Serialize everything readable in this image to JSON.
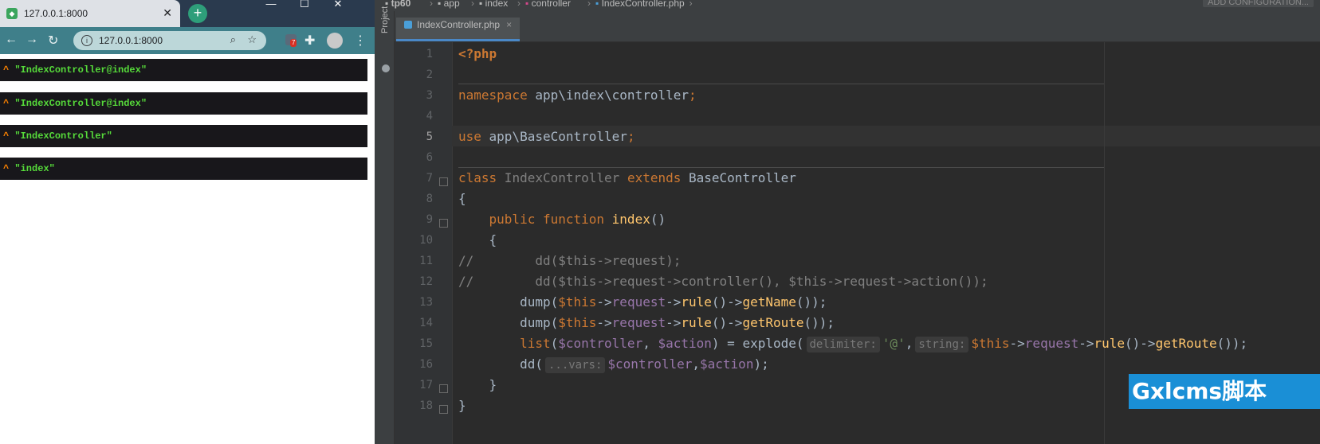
{
  "browser": {
    "tab_title": "127.0.0.1:8000",
    "tab_close": "✕",
    "new_tab": "+",
    "window_buttons": [
      "—",
      "☐",
      "✕"
    ],
    "url": "127.0.0.1:8000",
    "extension_badge": "7",
    "dumps": [
      "\"IndexController@index\"",
      "\"IndexController@index\"",
      "\"IndexController\"",
      "\"index\""
    ],
    "dump_prefix": "^"
  },
  "ide": {
    "breadcrumb": [
      "tp60",
      "app",
      "index",
      "controller",
      "IndexController.php"
    ],
    "add_configuration": "ADD CONFIGURATION...",
    "project_label": "Project",
    "active_tab": "IndexController.php",
    "tab_close": "×",
    "line_numbers": [
      "1",
      "2",
      "3",
      "4",
      "5",
      "6",
      "7",
      "8",
      "9",
      "10",
      "11",
      "12",
      "13",
      "14",
      "15",
      "16",
      "17",
      "18"
    ],
    "current_line": 5,
    "code": {
      "l1": "<?php",
      "l3_kw": "namespace",
      "l3_rest": " app\\index\\controller",
      "l3_semi": ";",
      "l5_kw": "use",
      "l5_rest": " app\\BaseController",
      "l5_semi": ";",
      "l7_kw1": "class",
      "l7_name": " IndexController ",
      "l7_kw2": "extends",
      "l7_base": " BaseController",
      "l8": "{",
      "l9_indent": "    ",
      "l9_kw": "public function",
      "l9_fn": " index",
      "l9_rest": "()",
      "l10": "    {",
      "l11": "//        dd($this->request);",
      "l12": "//        dd($this->request->controller(), $this->request->action());",
      "l13_a": "        dump(",
      "l13_var": "$this",
      "l13_b": "->",
      "l13_m1": "request",
      "l13_c": "->",
      "l13_f1": "rule",
      "l13_d": "()->",
      "l13_f2": "getName",
      "l13_e": "());",
      "l14_a": "        dump(",
      "l14_var": "$this",
      "l14_b": "->",
      "l14_m1": "request",
      "l14_c": "->",
      "l14_f1": "rule",
      "l14_d": "()->",
      "l14_f2": "getRoute",
      "l14_e": "());",
      "l15_kw": "        list",
      "l15_a": "(",
      "l15_v1": "$controller",
      "l15_b": ", ",
      "l15_v2": "$action",
      "l15_c": ") = explode(",
      "l15_hint1": "delimiter:",
      "l15_str": "'@'",
      "l15_d": ",",
      "l15_hint2": "string:",
      "l15_var": "$this",
      "l15_e": "->",
      "l15_m1": "request",
      "l15_f": "->",
      "l15_f1": "rule",
      "l15_g": "()->",
      "l15_f2": "getRoute",
      "l15_h": "());",
      "l16_a": "        dd(",
      "l16_hint": "...vars:",
      "l16_v1": "$controller",
      "l16_b": ",",
      "l16_v2": "$action",
      "l16_c": ");",
      "l17": "    }",
      "l18": "}"
    }
  },
  "watermark": "Gxlcms脚本"
}
